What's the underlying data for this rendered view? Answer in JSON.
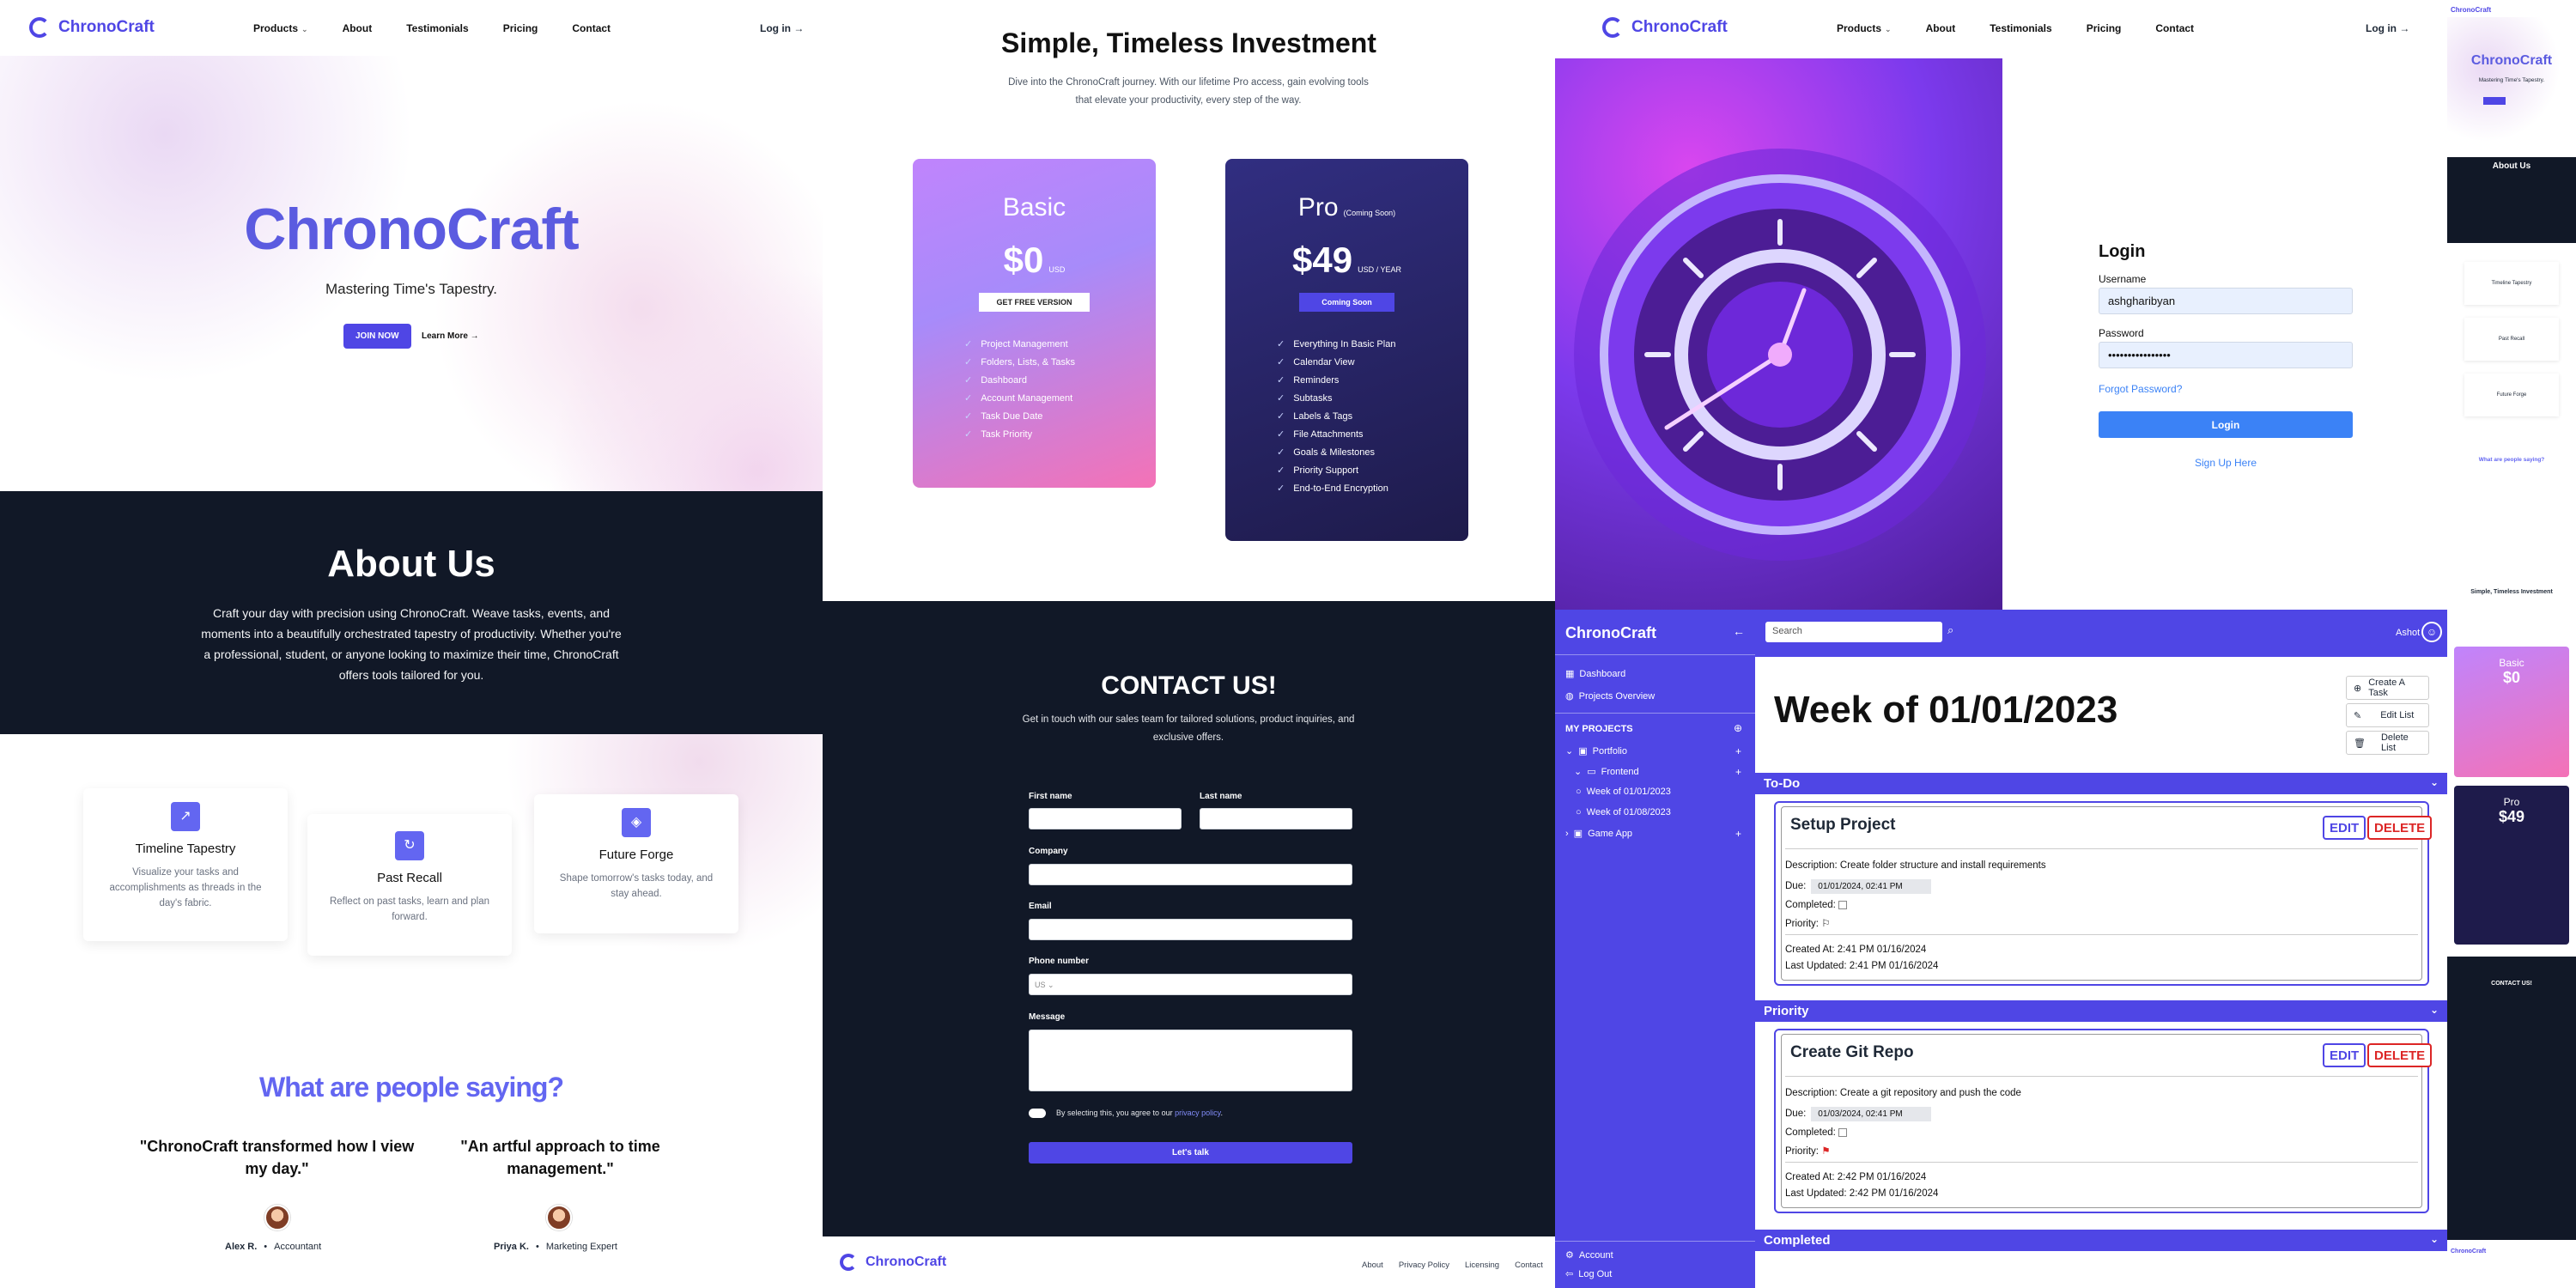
{
  "brand": "ChronoCraft",
  "nav": {
    "products": "Products",
    "about": "About",
    "testimonials": "Testimonials",
    "pricing": "Pricing",
    "contact": "Contact",
    "login": "Log in →"
  },
  "hero": {
    "title": "ChronoCraft",
    "subtitle": "Mastering Time's Tapestry.",
    "join": "JOIN NOW",
    "learn": "Learn More →"
  },
  "about": {
    "title": "About Us",
    "text": "Craft your day with precision using ChronoCraft. Weave tasks, events, and moments into a beautifully orchestrated tapestry of productivity. Whether you're a professional, student, or anyone looking to maximize their time, ChronoCraft offers tools tailored for you."
  },
  "features": [
    {
      "title": "Timeline Tapestry",
      "text": "Visualize your tasks and accomplishments as threads in the day's fabric."
    },
    {
      "title": "Past Recall",
      "text": "Reflect on past tasks, learn and plan forward."
    },
    {
      "title": "Future Forge",
      "text": "Shape tomorrow's tasks today, and stay ahead."
    }
  ],
  "testimonials": {
    "title": "What are people saying?",
    "items": [
      {
        "quote": "\"ChronoCraft transformed how I view my day.\"",
        "name": "Alex R.",
        "role": "Accountant"
      },
      {
        "quote": "\"An artful approach to time management.\"",
        "name": "Priya K.",
        "role": "Marketing Expert"
      }
    ]
  },
  "pricing": {
    "title": "Simple, Timeless Investment",
    "subtitle": "Dive into the ChronoCraft journey. With our lifetime Pro access, gain evolving tools that elevate your productivity, every step of the way.",
    "basic": {
      "name": "Basic",
      "price": "$0",
      "unit": "USD",
      "button": "GET FREE VERSION",
      "features": [
        "Project Management",
        "Folders, Lists, & Tasks",
        "Dashboard",
        "Account Management",
        "Task Due Date",
        "Task Priority"
      ]
    },
    "pro": {
      "name": "Pro",
      "note": "(Coming Soon)",
      "price": "$49",
      "unit": "USD / YEAR",
      "button": "Coming Soon",
      "features": [
        "Everything In Basic Plan",
        "Calendar View",
        "Reminders",
        "Subtasks",
        "Labels & Tags",
        "File Attachments",
        "Goals & Milestones",
        "Priority Support",
        "End-to-End Encryption"
      ]
    }
  },
  "contact": {
    "title": "CONTACT US!",
    "subtitle": "Get in touch with our sales team for tailored solutions, product inquiries, and exclusive offers.",
    "first": "First name",
    "last": "Last name",
    "company": "Company",
    "email": "Email",
    "phone": "Phone number",
    "country": "US",
    "message": "Message",
    "agree": "By selecting this, you agree to our",
    "policy": "privacy policy",
    "submit": "Let's talk"
  },
  "footer": {
    "about": "About",
    "privacy": "Privacy Policy",
    "licensing": "Licensing",
    "contact": "Contact"
  },
  "login": {
    "title": "Login",
    "username_label": "Username",
    "username": "ashgharibyan",
    "password_label": "Password",
    "password": "••••••••••••••••",
    "forgot": "Forgot Password?",
    "button": "Login",
    "signup": "Sign Up Here"
  },
  "app": {
    "brand": "ChronoCraft",
    "search_placeholder": "Search",
    "user": "Ashot",
    "nav": {
      "dashboard": "Dashboard",
      "projects": "Projects Overview",
      "my_projects": "MY PROJECTS",
      "portfolio": "Portfolio",
      "frontend": "Frontend",
      "week1": "Week of 01/01/2023",
      "week2": "Week of 01/08/2023",
      "game": "Game App",
      "account": "Account",
      "logout": "Log Out"
    },
    "page_title": "Week of 01/01/2023",
    "actions": {
      "add": "Create A Task",
      "edit": "Edit List",
      "delete": "Delete List"
    },
    "sections": {
      "todo": "To-Do",
      "priority": "Priority",
      "completed": "Completed"
    },
    "edit": "EDIT",
    "del": "DELETE",
    "labels": {
      "due": "Due:",
      "completed": "Completed:",
      "priority": "Priority:"
    },
    "tasks": [
      {
        "title": "Setup Project",
        "desc": "Description: Create folder structure and install requirements",
        "due": "01/01/2024, 02:41 PM",
        "created": "Created At: 2:41 PM 01/16/2024",
        "updated": "Last Updated: 2:41 PM 01/16/2024"
      },
      {
        "title": "Create Git Repo",
        "desc": "Description: Create a git repository and push the code",
        "due": "01/03/2024, 02:41 PM",
        "created": "Created At: 2:42 PM 01/16/2024",
        "updated": "Last Updated: 2:42 PM 01/16/2024"
      }
    ]
  },
  "colors": {
    "brand": "#4f46e5",
    "dark": "#111827",
    "delete": "#dc2626",
    "login": "#3b82f6"
  }
}
